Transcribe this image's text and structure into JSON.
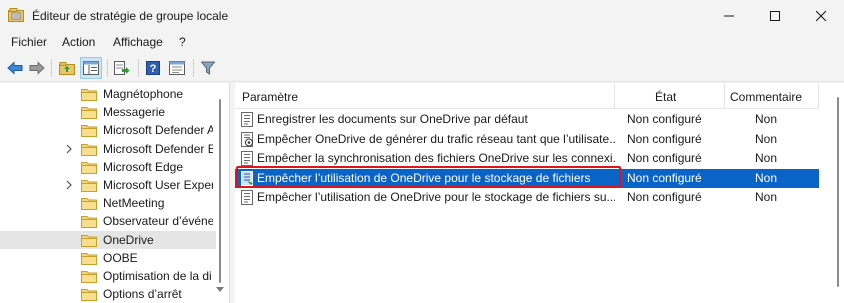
{
  "window": {
    "title": "Éditeur de stratégie de groupe locale",
    "icons": [
      "app-icon",
      "minimize-icon",
      "maximize-icon",
      "close-icon"
    ]
  },
  "menubar": {
    "items": [
      {
        "label": "Fichier"
      },
      {
        "label": "Action"
      },
      {
        "label": "Affichage"
      },
      {
        "label": "?"
      }
    ]
  },
  "toolbar": {
    "buttons": [
      "back-icon",
      "forward-icon",
      "up-folder-icon",
      "show-hide-tree-icon",
      "export-list-icon",
      "help-icon",
      "properties-icon",
      "filter-icon"
    ]
  },
  "tree": {
    "items": [
      {
        "label": "Magnétophone",
        "expandable": false
      },
      {
        "label": "Messagerie",
        "expandable": false
      },
      {
        "label": "Microsoft Defender A",
        "expandable": false
      },
      {
        "label": "Microsoft Defender E",
        "expandable": true
      },
      {
        "label": "Microsoft Edge",
        "expandable": false
      },
      {
        "label": "Microsoft User Exper",
        "expandable": true
      },
      {
        "label": "NetMeeting",
        "expandable": false
      },
      {
        "label": "Observateur d’événe",
        "expandable": false
      },
      {
        "label": "OneDrive",
        "expandable": false,
        "selected": true
      },
      {
        "label": "OOBE",
        "expandable": false
      },
      {
        "label": "Optimisation de la di",
        "expandable": false
      },
      {
        "label": "Options d’arrêt",
        "expandable": false
      }
    ]
  },
  "list": {
    "headers": {
      "name": "Paramètre",
      "state": "État",
      "comment": "Commentaire"
    },
    "rows": [
      {
        "name": "Enregistrer les documents sur OneDrive par défaut",
        "state": "Non configuré",
        "comment": "Non",
        "icon": "policy-setting-icon"
      },
      {
        "name": "Empêcher OneDrive de générer du trafic réseau tant que l’utilisate...",
        "state": "Non configuré",
        "comment": "Non",
        "icon": "policy-setting-network-icon"
      },
      {
        "name": "Empêcher la synchronisation des fichiers OneDrive sur les connexi...",
        "state": "Non configuré",
        "comment": "Non",
        "icon": "policy-setting-icon"
      },
      {
        "name": "Empêcher l’utilisation de OneDrive pour le stockage de fichiers",
        "state": "Non configuré",
        "comment": "Non",
        "icon": "policy-setting-selected-icon",
        "selected": true
      },
      {
        "name": "Empêcher l’utilisation de OneDrive pour le stockage de fichiers su...",
        "state": "Non configuré",
        "comment": "Non",
        "icon": "policy-setting-icon"
      }
    ],
    "selected_row_color": "#0a64c8",
    "highlight_color": "#e0121a"
  }
}
